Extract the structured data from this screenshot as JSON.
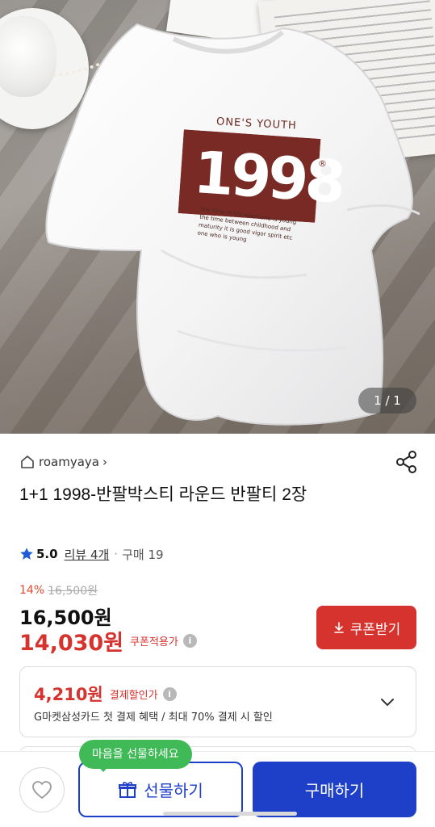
{
  "product_image": {
    "counter": "1 / 1",
    "print": {
      "title": "ONE'S YOUTH",
      "year": "1998",
      "mark": "®",
      "text": "the time of life when one is young\nthe time between childhood and\nmaturity it is good vigor spirit etc\none who is young"
    }
  },
  "seller": {
    "name": "roamyaya",
    "chevron": "›"
  },
  "product": {
    "title": "1+1 1998-반팔박스티 라운드 반팔티 2장"
  },
  "rating": {
    "score": "5.0",
    "review_label": "리뷰 4개",
    "separator": "·",
    "purchase_label": "구매 19",
    "star_color": "#1e5bd8"
  },
  "price": {
    "discount_rate": "14%",
    "original": "16,500원",
    "current": "16,500원",
    "coupon_price": "14,030원",
    "coupon_tag": "쿠폰적용가",
    "coupon_button": "쿠폰받기"
  },
  "payment_discount": {
    "price": "4,210원",
    "tag": "결제할인가",
    "description": "G마켓삼성카드 첫 결제 혜택 / 최대 70% 결제 시 할인"
  },
  "bottom_bar": {
    "gift_bubble": "마음을 선물하세요",
    "gift_button": "선물하기",
    "buy_button": "구매하기"
  },
  "colors": {
    "accent_blue": "#1e40c8",
    "sale_red": "#d6322e",
    "bubble_green": "#3fba57",
    "print_maroon": "#7a2a24"
  }
}
